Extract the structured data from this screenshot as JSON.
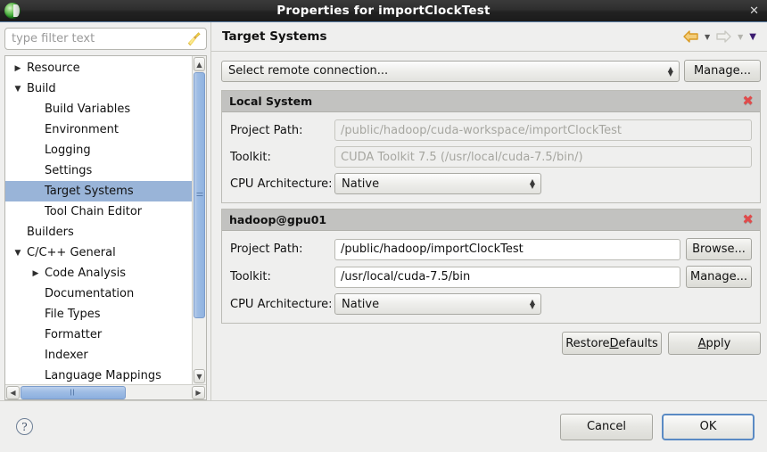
{
  "window": {
    "title": "Properties for importClockTest",
    "app_icon": "eclipse-sphere-icon",
    "close_label": "✕"
  },
  "sidebar": {
    "filter": {
      "value": "",
      "placeholder": "type filter text"
    },
    "clear_icon": "broom-icon",
    "items": [
      {
        "label": "Resource",
        "indent": 0,
        "twisty": "collapsed",
        "selected": false
      },
      {
        "label": "Build",
        "indent": 0,
        "twisty": "expanded",
        "selected": false
      },
      {
        "label": "Build Variables",
        "indent": 1,
        "twisty": "none",
        "selected": false
      },
      {
        "label": "Environment",
        "indent": 1,
        "twisty": "none",
        "selected": false
      },
      {
        "label": "Logging",
        "indent": 1,
        "twisty": "none",
        "selected": false
      },
      {
        "label": "Settings",
        "indent": 1,
        "twisty": "none",
        "selected": false
      },
      {
        "label": "Target Systems",
        "indent": 1,
        "twisty": "none",
        "selected": true
      },
      {
        "label": "Tool Chain Editor",
        "indent": 1,
        "twisty": "none",
        "selected": false
      },
      {
        "label": "Builders",
        "indent": 0,
        "twisty": "none",
        "selected": false
      },
      {
        "label": "C/C++ General",
        "indent": 0,
        "twisty": "expanded",
        "selected": false
      },
      {
        "label": "Code Analysis",
        "indent": 1,
        "twisty": "collapsed",
        "selected": false
      },
      {
        "label": "Documentation",
        "indent": 1,
        "twisty": "none",
        "selected": false
      },
      {
        "label": "File Types",
        "indent": 1,
        "twisty": "none",
        "selected": false
      },
      {
        "label": "Formatter",
        "indent": 1,
        "twisty": "none",
        "selected": false
      },
      {
        "label": "Indexer",
        "indent": 1,
        "twisty": "none",
        "selected": false
      },
      {
        "label": "Language Mappings",
        "indent": 1,
        "twisty": "none",
        "selected": false
      }
    ]
  },
  "page": {
    "title": "Target Systems",
    "nav": {
      "back_icon": "back-arrow-icon",
      "back_menu_icon": "chevron-down-icon",
      "forward_icon": "forward-arrow-icon",
      "forward_menu_icon": "chevron-down-icon",
      "view_menu_icon": "triangle-down-icon"
    },
    "connection": {
      "selected": "Select remote connection...",
      "manage_label": "Manage..."
    },
    "groups": [
      {
        "title": "Local System",
        "close_icon": "close-red-x-icon",
        "project_path": {
          "label": "Project Path:",
          "value": "/public/hadoop/cuda-workspace/importClockTest",
          "disabled": true,
          "button": null
        },
        "toolkit": {
          "label": "Toolkit:",
          "value": "CUDA Toolkit 7.5 (/usr/local/cuda-7.5/bin/)",
          "disabled": true,
          "button": null
        },
        "cpu_architecture": {
          "label": "CPU Architecture:",
          "value": "Native"
        }
      },
      {
        "title": "hadoop@gpu01",
        "close_icon": "close-red-x-icon",
        "project_path": {
          "label": "Project Path:",
          "value": "/public/hadoop/importClockTest",
          "disabled": false,
          "button": "Browse..."
        },
        "toolkit": {
          "label": "Toolkit:",
          "value": "/usr/local/cuda-7.5/bin",
          "disabled": false,
          "button": "Manage..."
        },
        "cpu_architecture": {
          "label": "CPU Architecture:",
          "value": "Native"
        }
      }
    ],
    "actions": {
      "restore_defaults": {
        "pre": "Restore ",
        "mnemonic": "D",
        "post": "efaults"
      },
      "apply": {
        "pre": "",
        "mnemonic": "A",
        "post": "pply"
      }
    }
  },
  "footer": {
    "help_icon": "question-mark-icon",
    "help_glyph": "?",
    "cancel_label": "Cancel",
    "ok_label": "OK"
  },
  "colors": {
    "selection": "#99b4d8",
    "group_header": "#c2c2c0",
    "close_x": "#e04b4b",
    "dialog_bg": "#efefee",
    "focus_border": "#5a8ac4",
    "back_arrow": "#e8a33d",
    "forward_arrow": "#cfcfc8",
    "menu_triangle": "#3b1b70"
  }
}
